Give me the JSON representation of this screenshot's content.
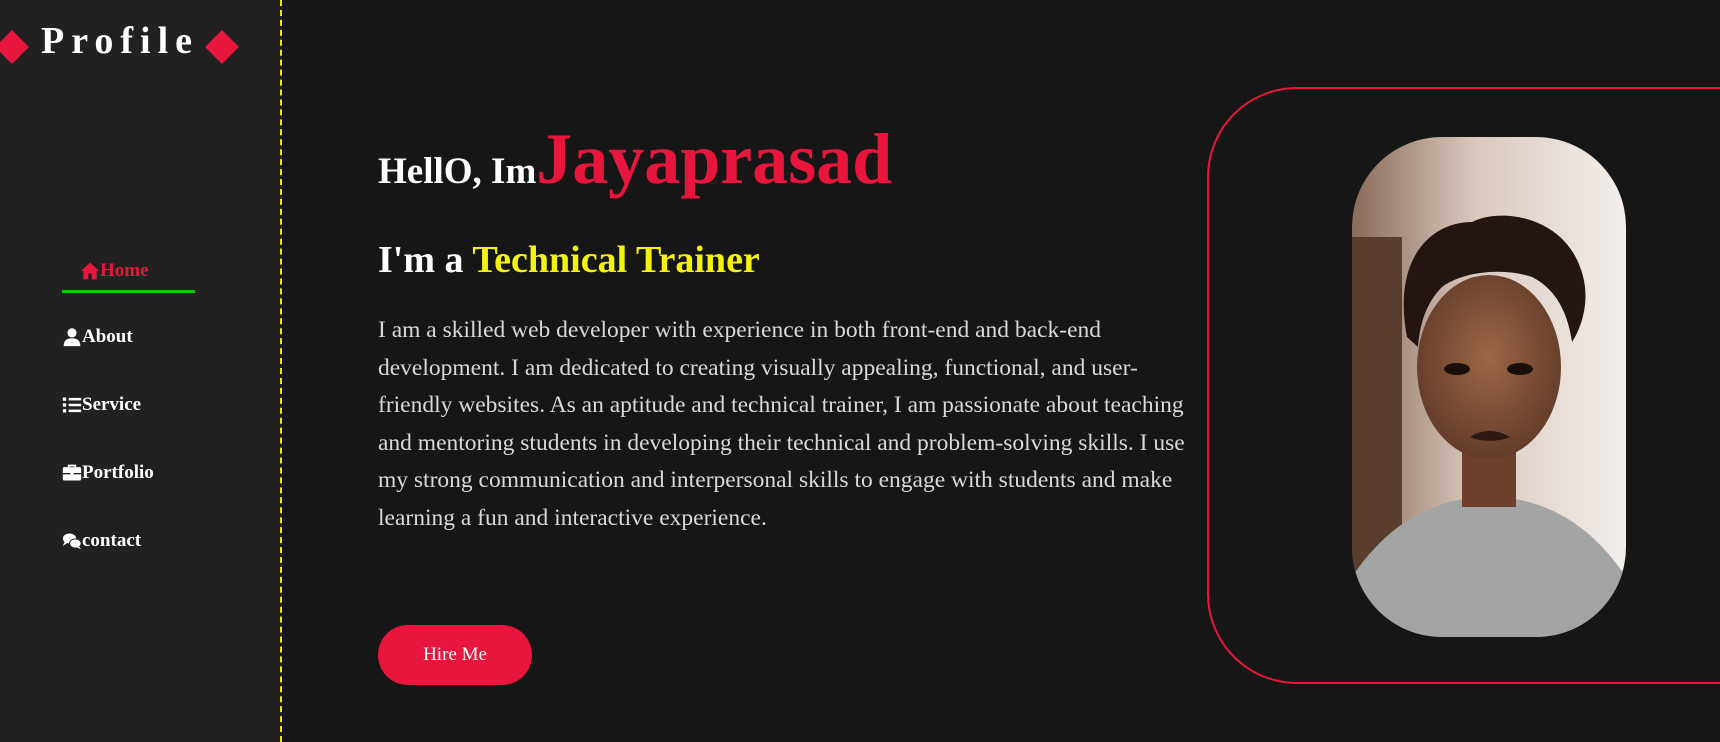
{
  "sidebar": {
    "logo_text": "Profile",
    "items": [
      {
        "label": "Home",
        "icon": "home-icon",
        "active": true
      },
      {
        "label": "About",
        "icon": "user-icon",
        "active": false
      },
      {
        "label": "Service",
        "icon": "list-icon",
        "active": false
      },
      {
        "label": "Portfolio",
        "icon": "briefcase-icon",
        "active": false
      },
      {
        "label": "contact",
        "icon": "comments-icon",
        "active": false
      }
    ]
  },
  "hero": {
    "greeting_prefix": "HellO, Im",
    "name": "Jayaprasad",
    "role_prefix": "I'm a ",
    "role_title": "Technical Trainer",
    "bio": "I am a skilled web developer with experience in both front-end and back-end development. I am dedicated to creating visually appealing, functional, and user-friendly websites. As an aptitude and technical trainer, I am passionate about teaching and mentoring students in developing their technical and problem-solving skills. I use my strong communication and interpersonal skills to engage with students and make learning a fun and interactive experience.",
    "button_label": "Hire Me"
  },
  "colors": {
    "accent": "#e8163c",
    "highlight": "#f4f40a",
    "active_underline": "#13c213",
    "sidebar_divider": "#f4e409",
    "background": "#161617",
    "sidebar_background": "#212121"
  }
}
